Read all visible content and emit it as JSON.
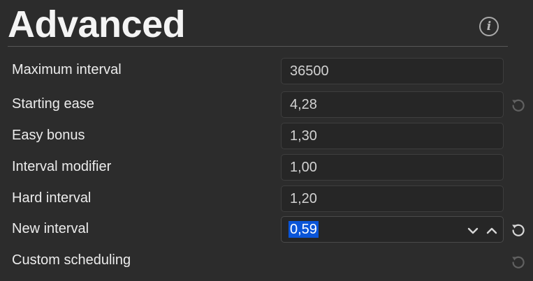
{
  "section": {
    "title": "Advanced",
    "info_icon": "i"
  },
  "rows": [
    {
      "label": "Maximum interval",
      "value": "36500"
    },
    {
      "label": "Starting ease",
      "value": "4,28"
    },
    {
      "label": "Easy bonus",
      "value": "1,30"
    },
    {
      "label": "Interval modifier",
      "value": "1,00"
    },
    {
      "label": "Hard interval",
      "value": "1,20"
    },
    {
      "label": "New interval",
      "value": "0,59"
    },
    {
      "label": "Custom scheduling"
    }
  ],
  "icons": {
    "info": "info-icon",
    "reset": "reset-icon",
    "increment": "chevron-up-icon",
    "decrement": "chevron-down-icon"
  },
  "colors": {
    "background": "#2c2c2c",
    "field_background": "#262626",
    "selection": "#0a55d8"
  }
}
